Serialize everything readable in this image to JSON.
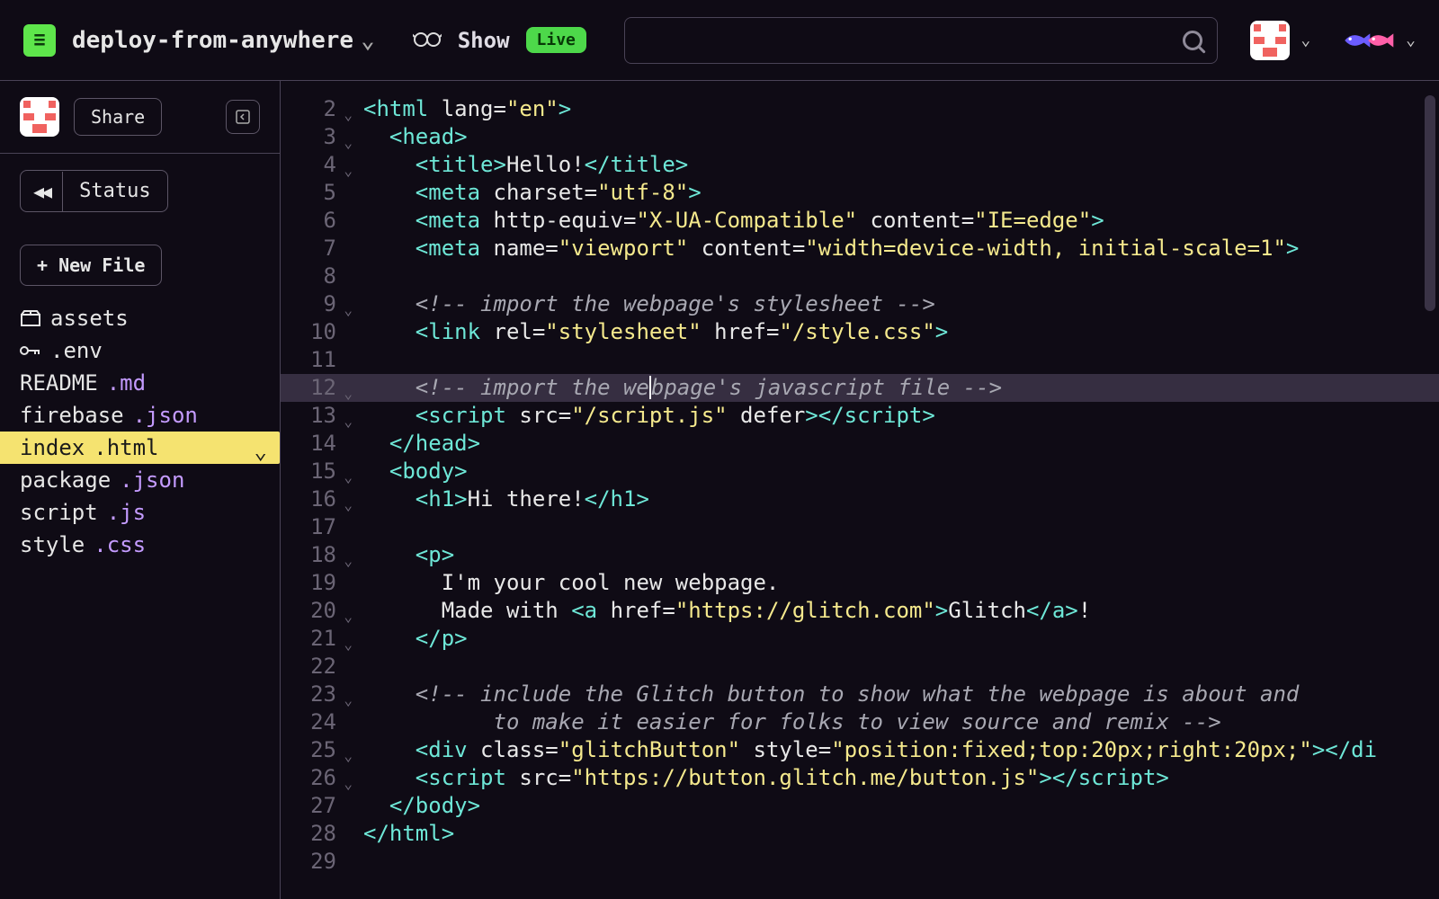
{
  "header": {
    "project_name": "deploy-from-anywhere",
    "show_label": "Show",
    "live_label": "Live",
    "search_placeholder": ""
  },
  "sidebar": {
    "share_label": "Share",
    "status_label": "Status",
    "rewind_symbol": "◀◀",
    "new_file_label": "+ New File",
    "files": [
      {
        "name": "assets",
        "ext": "",
        "kind": "folder",
        "icon": "box"
      },
      {
        "name": ".env",
        "ext": "",
        "kind": "env",
        "icon": "key"
      },
      {
        "name": "README",
        "ext": ".md",
        "kind": "file"
      },
      {
        "name": "firebase",
        "ext": ".json",
        "kind": "file"
      },
      {
        "name": "index",
        "ext": ".html",
        "kind": "file",
        "selected": true
      },
      {
        "name": "package",
        "ext": ".json",
        "kind": "file"
      },
      {
        "name": "script",
        "ext": ".js",
        "kind": "file"
      },
      {
        "name": "style",
        "ext": ".css",
        "kind": "file"
      }
    ]
  },
  "editor": {
    "active_line": 12,
    "lines": [
      {
        "n": 2,
        "fold": true,
        "indent": 0,
        "tokens": [
          {
            "t": "tag",
            "v": "<html"
          },
          {
            "t": "txt",
            "v": " "
          },
          {
            "t": "attr",
            "v": "lang="
          },
          {
            "t": "str",
            "v": "\"en\""
          },
          {
            "t": "tag",
            "v": ">"
          }
        ]
      },
      {
        "n": 3,
        "fold": true,
        "indent": 1,
        "tokens": [
          {
            "t": "tag",
            "v": "<head>"
          }
        ]
      },
      {
        "n": 4,
        "fold": true,
        "indent": 2,
        "tokens": [
          {
            "t": "tag",
            "v": "<title>"
          },
          {
            "t": "txt",
            "v": "Hello!"
          },
          {
            "t": "tag",
            "v": "</title>"
          }
        ]
      },
      {
        "n": 5,
        "indent": 2,
        "tokens": [
          {
            "t": "tag",
            "v": "<meta"
          },
          {
            "t": "txt",
            "v": " "
          },
          {
            "t": "attr",
            "v": "charset="
          },
          {
            "t": "str",
            "v": "\"utf-8\""
          },
          {
            "t": "tag",
            "v": ">"
          }
        ]
      },
      {
        "n": 6,
        "indent": 2,
        "tokens": [
          {
            "t": "tag",
            "v": "<meta"
          },
          {
            "t": "txt",
            "v": " "
          },
          {
            "t": "attr",
            "v": "http-equiv="
          },
          {
            "t": "str",
            "v": "\"X-UA-Compatible\""
          },
          {
            "t": "txt",
            "v": " "
          },
          {
            "t": "attr",
            "v": "content="
          },
          {
            "t": "str",
            "v": "\"IE=edge\""
          },
          {
            "t": "tag",
            "v": ">"
          }
        ]
      },
      {
        "n": 7,
        "indent": 2,
        "tokens": [
          {
            "t": "tag",
            "v": "<meta"
          },
          {
            "t": "txt",
            "v": " "
          },
          {
            "t": "attr",
            "v": "name="
          },
          {
            "t": "str",
            "v": "\"viewport\""
          },
          {
            "t": "txt",
            "v": " "
          },
          {
            "t": "attr",
            "v": "content="
          },
          {
            "t": "str",
            "v": "\"width=device-width, initial-scale=1\""
          },
          {
            "t": "tag",
            "v": ">"
          }
        ]
      },
      {
        "n": 8,
        "indent": 0,
        "tokens": []
      },
      {
        "n": 9,
        "fold": true,
        "indent": 2,
        "tokens": [
          {
            "t": "cmt",
            "v": "<!-- import the webpage's stylesheet -->"
          }
        ]
      },
      {
        "n": 10,
        "indent": 2,
        "tokens": [
          {
            "t": "tag",
            "v": "<link"
          },
          {
            "t": "txt",
            "v": " "
          },
          {
            "t": "attr",
            "v": "rel="
          },
          {
            "t": "str",
            "v": "\"stylesheet\""
          },
          {
            "t": "txt",
            "v": " "
          },
          {
            "t": "attr",
            "v": "href="
          },
          {
            "t": "str",
            "v": "\"/style.css\""
          },
          {
            "t": "tag",
            "v": ">"
          }
        ]
      },
      {
        "n": 11,
        "indent": 0,
        "tokens": []
      },
      {
        "n": 12,
        "fold": true,
        "hl": true,
        "indent": 2,
        "tokens": [
          {
            "t": "cmt",
            "v": "<!-- import the we"
          },
          {
            "t": "cursor",
            "v": ""
          },
          {
            "t": "cmt",
            "v": "bpage's javascript file -->"
          }
        ]
      },
      {
        "n": 13,
        "fold": true,
        "indent": 2,
        "tokens": [
          {
            "t": "tag",
            "v": "<script"
          },
          {
            "t": "txt",
            "v": " "
          },
          {
            "t": "attr",
            "v": "src="
          },
          {
            "t": "str",
            "v": "\"/script.js\""
          },
          {
            "t": "txt",
            "v": " "
          },
          {
            "t": "attr",
            "v": "defer"
          },
          {
            "t": "tag",
            "v": ">"
          },
          {
            "t": "tag",
            "v": "</script>"
          }
        ]
      },
      {
        "n": 14,
        "indent": 1,
        "tokens": [
          {
            "t": "tag",
            "v": "</head>"
          }
        ]
      },
      {
        "n": 15,
        "fold": true,
        "indent": 1,
        "tokens": [
          {
            "t": "tag",
            "v": "<body>"
          }
        ]
      },
      {
        "n": 16,
        "fold": true,
        "indent": 2,
        "tokens": [
          {
            "t": "tag",
            "v": "<h1>"
          },
          {
            "t": "txt",
            "v": "Hi there!"
          },
          {
            "t": "tag",
            "v": "</h1>"
          }
        ]
      },
      {
        "n": 17,
        "indent": 0,
        "tokens": []
      },
      {
        "n": 18,
        "fold": true,
        "indent": 2,
        "tokens": [
          {
            "t": "tag",
            "v": "<p>"
          }
        ]
      },
      {
        "n": 19,
        "indent": 3,
        "tokens": [
          {
            "t": "txt",
            "v": "I'm your cool new webpage."
          }
        ]
      },
      {
        "n": 20,
        "fold": true,
        "indent": 3,
        "tokens": [
          {
            "t": "txt",
            "v": "Made with "
          },
          {
            "t": "tag",
            "v": "<a"
          },
          {
            "t": "txt",
            "v": " "
          },
          {
            "t": "attr",
            "v": "href="
          },
          {
            "t": "str",
            "v": "\"https://glitch.com\""
          },
          {
            "t": "tag",
            "v": ">"
          },
          {
            "t": "txt",
            "v": "Glitch"
          },
          {
            "t": "tag",
            "v": "</a>"
          },
          {
            "t": "txt",
            "v": "!"
          }
        ]
      },
      {
        "n": 21,
        "fold": true,
        "indent": 2,
        "tokens": [
          {
            "t": "tag",
            "v": "</p>"
          }
        ]
      },
      {
        "n": 22,
        "indent": 0,
        "tokens": []
      },
      {
        "n": 23,
        "fold": true,
        "indent": 2,
        "tokens": [
          {
            "t": "cmt",
            "v": "<!-- include the Glitch button to show what the webpage is about and"
          }
        ]
      },
      {
        "n": 24,
        "indent": 5,
        "tokens": [
          {
            "t": "cmt",
            "v": "to make it easier for folks to view source and remix -->"
          }
        ]
      },
      {
        "n": 25,
        "fold": true,
        "indent": 2,
        "tokens": [
          {
            "t": "tag",
            "v": "<div"
          },
          {
            "t": "txt",
            "v": " "
          },
          {
            "t": "attr",
            "v": "class="
          },
          {
            "t": "str",
            "v": "\"glitchButton\""
          },
          {
            "t": "txt",
            "v": " "
          },
          {
            "t": "attr",
            "v": "style="
          },
          {
            "t": "str",
            "v": "\"position:fixed;top:20px;right:20px;\""
          },
          {
            "t": "tag",
            "v": ">"
          },
          {
            "t": "tag",
            "v": "</di"
          }
        ]
      },
      {
        "n": 26,
        "fold": true,
        "indent": 2,
        "tokens": [
          {
            "t": "tag",
            "v": "<script"
          },
          {
            "t": "txt",
            "v": " "
          },
          {
            "t": "attr",
            "v": "src="
          },
          {
            "t": "str",
            "v": "\"https://button.glitch.me/button.js\""
          },
          {
            "t": "tag",
            "v": ">"
          },
          {
            "t": "tag",
            "v": "</script>"
          }
        ]
      },
      {
        "n": 27,
        "indent": 1,
        "tokens": [
          {
            "t": "tag",
            "v": "</body>"
          }
        ]
      },
      {
        "n": 28,
        "indent": 0,
        "tokens": [
          {
            "t": "tag",
            "v": "</html>"
          }
        ]
      },
      {
        "n": 29,
        "indent": 0,
        "tokens": []
      }
    ]
  }
}
